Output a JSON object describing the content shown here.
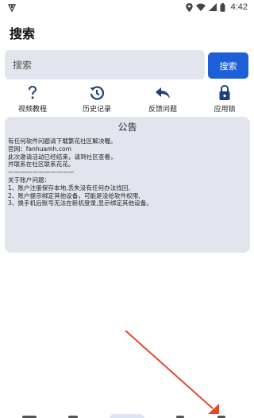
{
  "status_bar": {
    "time": "4:42"
  },
  "page": {
    "title": "搜索"
  },
  "search": {
    "placeholder": "搜索",
    "button_label": "搜索"
  },
  "shortcuts": [
    {
      "label": "视频教程",
      "icon": "question-icon"
    },
    {
      "label": "历史记录",
      "icon": "history-icon"
    },
    {
      "label": "反馈问题",
      "icon": "reply-icon"
    },
    {
      "label": "应用锁",
      "icon": "lock-icon"
    }
  ],
  "notice": {
    "title": "公告",
    "body": "有任何软件问题请下载繁花社区解决喔。\n官网：fanhuamh.com\n此次邀请活动已经结束，请到社区查看，\n并联系在社区联系花花。\n———————————\n关于账户问题：\n1、账户注册保存本地,丢失没有任何办法找回,\n2、账户提示绑定其他设备，可能是没给软件权限,\n3、换手机后账号无法在新机登录,显示绑定其他设备。"
  },
  "colors": {
    "accent": "#1d5fd6",
    "card_bg": "#e3e5ee",
    "arrow": "#e8452c"
  }
}
